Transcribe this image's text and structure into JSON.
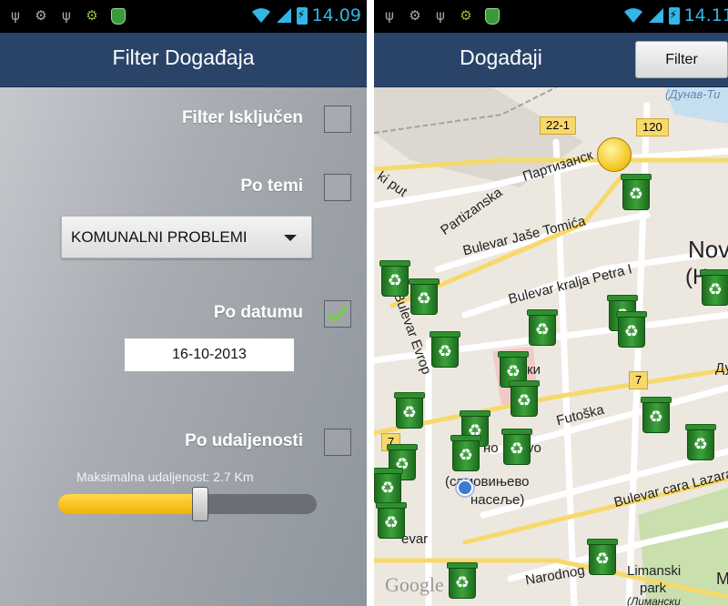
{
  "left_screen": {
    "status": {
      "time": "14.09"
    },
    "title": "Filter Događaja",
    "filter_off": {
      "label": "Filter Isključen",
      "checked": false
    },
    "by_topic": {
      "label": "Po temi",
      "checked": false
    },
    "topic_spinner": {
      "value": "KOMUNALNI PROBLEMI"
    },
    "by_date": {
      "label": "Po datumu",
      "checked": true
    },
    "date_value": "16-10-2013",
    "by_distance": {
      "label": "Po udaljenosti",
      "checked": false
    },
    "max_distance_label": "Maksimalna udaljenost: 2.7 Km",
    "slider_fraction": 0.55,
    "colors": {
      "titlebar": "#2a4469",
      "slider_fill": "#f0b400",
      "status_accent": "#33b5e5",
      "checkmark": "#7ccc4a"
    }
  },
  "right_screen": {
    "status": {
      "time": "14.11"
    },
    "title": "Događaji",
    "filter_button": "Filter",
    "map": {
      "labels": {
        "dunav": "(Дунав-Ти",
        "road_22": "22-1",
        "road_120": "120",
        "partizanska_cyr": "Партизанск",
        "partizanska": "Partizanska",
        "ki_put": "ki put",
        "jase_tomica": "Bulevar Jaše Tomića",
        "kralja_petra": "Bulevar kralja Petra I",
        "nov": "Nov",
        "nov_paren": "(Н",
        "evropa": "Bulevar Evrop",
        "dy": "Ду",
        "road_7a": "7",
        "road_7b": "7",
        "futoska": "Futoška",
        "sanki": "шки",
        "novo": "но",
        "vo": "vo",
        "samovinevo": "(самовињево",
        "naselje": "насеље)",
        "cara_lazara": "Bulevar cara Lazara",
        "evrop2": "evar",
        "narodnog": "Narodnog",
        "limanski": "Limanski",
        "park": "park",
        "limanski_cyr": "(Лимански",
        "m": "M",
        "google": "Google"
      }
    }
  }
}
